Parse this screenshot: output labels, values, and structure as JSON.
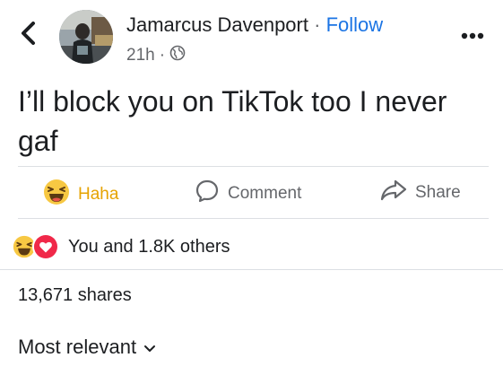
{
  "header": {
    "author_name": "Jamarcus Davenport",
    "separator": "·",
    "follow_label": "Follow",
    "timestamp": "21h",
    "meta_separator": "·",
    "privacy_icon": "globe-icon",
    "back_icon": "chevron-left-icon",
    "more_icon": "more-horizontal-icon"
  },
  "post": {
    "text": "I’ll block you on TikTok too I never gaf"
  },
  "actions": {
    "haha_label": "Haha",
    "haha_icon": "haha-emoji-icon",
    "comment_label": "Comment",
    "comment_icon": "comment-bubble-icon",
    "share_label": "Share",
    "share_icon": "share-arrow-icon"
  },
  "reactions": {
    "summary": "You and 1.8K others",
    "icons": [
      "haha-emoji-icon",
      "love-reaction-icon"
    ]
  },
  "stats": {
    "shares_text": "13,671 shares"
  },
  "comments": {
    "sort_label": "Most relevant",
    "sort_icon": "chevron-down-icon"
  },
  "colors": {
    "link_blue": "#1b74e4",
    "haha_yellow": "#e6a300",
    "muted_text": "#65676b",
    "love_red": "#f02849"
  }
}
